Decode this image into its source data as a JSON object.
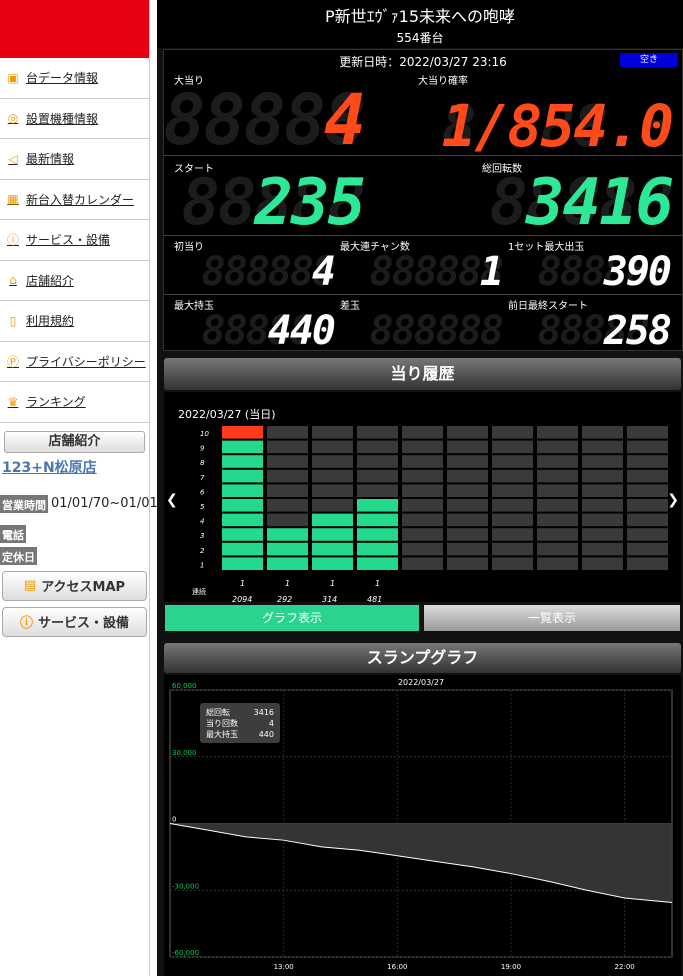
{
  "sidebar": {
    "menu": [
      {
        "label": "台データ情報",
        "icon": "data-icon"
      },
      {
        "label": "設置機種情報",
        "icon": "machine-icon"
      },
      {
        "label": "最新情報",
        "icon": "megaphone-icon"
      },
      {
        "label": "新台入替カレンダー",
        "icon": "calendar-icon"
      },
      {
        "label": "サービス・設備",
        "icon": "exclamation-icon"
      },
      {
        "label": "店舗紹介",
        "icon": "home-icon"
      },
      {
        "label": "利用規約",
        "icon": "terms-icon"
      },
      {
        "label": "プライバシーポリシー",
        "icon": "privacy-icon"
      },
      {
        "label": "ランキング",
        "icon": "crown-icon"
      }
    ],
    "shop_head": "店舗紹介",
    "shop_name": "123+N松原店",
    "hours_label": "営業時間",
    "hours_value": "01/01/70~01/01/70",
    "phone_label": "電話",
    "holiday_label": "定休日",
    "access_button": "アクセスMAP",
    "service_button": "サービス・設備"
  },
  "header": {
    "title": "P新世ｴｳﾞｧ15未来への咆哮",
    "machine_no": "554番台"
  },
  "stats": {
    "updated": "更新日時：2022/03/27 23:16",
    "status": "空き",
    "big_hit_label": "大当り",
    "big_hit": "4",
    "prob_label": "大当り確率",
    "prob": "1/854.0",
    "start_label": "スタート",
    "start": "235",
    "total_spins_label": "総回転数",
    "total_spins": "3416",
    "first_hit_label": "初当り",
    "first_hit": "4",
    "max_chain_label": "最大連チャン数",
    "max_chain": "1",
    "max_set_label": "1セット最大出玉",
    "max_set": "390",
    "max_hold_label": "最大持玉",
    "max_hold": "440",
    "diff_label": "差玉",
    "diff": "",
    "prev_start_label": "前日最終スタート",
    "prev_start": "258"
  },
  "history": {
    "heading": "当り履歴",
    "date": "2022/03/27 (当日)",
    "row_labels": [
      "10",
      "9",
      "8",
      "7",
      "6",
      "5",
      "4",
      "3",
      "2",
      "1"
    ],
    "chain_label": "連続",
    "columns": [
      {
        "chain": "1",
        "spins": "2094",
        "level": 10,
        "top_red": true
      },
      {
        "chain": "1",
        "spins": "292",
        "level": 3,
        "top_red": false
      },
      {
        "chain": "1",
        "spins": "314",
        "level": 4,
        "top_red": false
      },
      {
        "chain": "1",
        "spins": "481",
        "level": 5,
        "top_red": false
      }
    ],
    "total_columns": 10,
    "graph_tab": "グラフ表示",
    "list_tab": "一覧表示"
  },
  "chart_data": {
    "type": "area",
    "title": "2022/03/27",
    "heading": "スランプグラフ",
    "y_ticks": [
      "60,000",
      "30,000",
      "0",
      "-30,000",
      "-60,000"
    ],
    "ylim": [
      -60000,
      60000
    ],
    "x_ticks": [
      "13:00",
      "16:00",
      "19:00",
      "22:00"
    ],
    "xlim": [
      10.0,
      23.25
    ],
    "grid": true,
    "series": [
      {
        "x": [
          10.0,
          11.0,
          12.0,
          13.0,
          14.0,
          15.0,
          16.0,
          17.0,
          18.0,
          19.0,
          20.0,
          21.0,
          22.0,
          23.25
        ],
        "values": [
          0,
          -3000,
          -6000,
          -7500,
          -10500,
          -12000,
          -14500,
          -17000,
          -19500,
          -22500,
          -26000,
          -30000,
          -33500,
          -35500
        ]
      }
    ],
    "tooltip": [
      {
        "label": "総回転",
        "value": "3416"
      },
      {
        "label": "当り回数",
        "value": "4"
      },
      {
        "label": "最大持玉",
        "value": "440"
      }
    ],
    "colors": {
      "line": "#ffffff",
      "zero": "#cc0000",
      "fill": "#3a3a3a",
      "axis_text": "#00cc55"
    }
  }
}
